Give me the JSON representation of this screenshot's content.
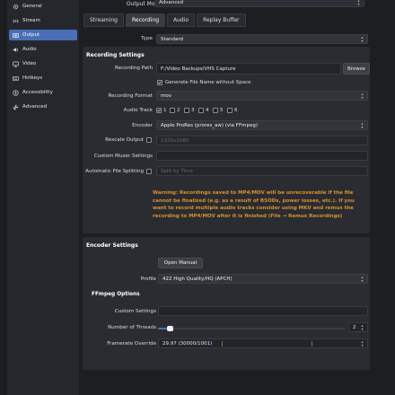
{
  "sidebar": {
    "items": [
      {
        "label": "General",
        "icon": "gear-icon"
      },
      {
        "label": "Stream",
        "icon": "broadcast-icon"
      },
      {
        "label": "Output",
        "icon": "output-icon"
      },
      {
        "label": "Audio",
        "icon": "speaker-icon"
      },
      {
        "label": "Video",
        "icon": "monitor-icon"
      },
      {
        "label": "Hotkeys",
        "icon": "keyboard-icon"
      },
      {
        "label": "Accessibility",
        "icon": "accessibility-icon"
      },
      {
        "label": "Advanced",
        "icon": "wrench-icon"
      }
    ],
    "active": "Output"
  },
  "output_mode": {
    "label": "Output Mode",
    "value": "Advanced"
  },
  "tabs": [
    "Streaming",
    "Recording",
    "Audio",
    "Replay Buffer"
  ],
  "active_tab": "Recording",
  "type": {
    "label": "Type",
    "value": "Standard"
  },
  "recording_settings": {
    "title": "Recording Settings",
    "path_label": "Recording Path",
    "path_value": "F:/Video Backups/VHS Capture",
    "browse": "Browse",
    "no_space_label": "Generate File Name without Space",
    "format_label": "Recording Format",
    "format_value": "mov",
    "audio_track_label": "Audio Track",
    "tracks": [
      "1",
      "2",
      "3",
      "4",
      "5",
      "6"
    ],
    "encoder_label": "Encoder",
    "encoder_value": "Apple ProRes (prores_aw) (via FFmpeg)",
    "rescale_label": "Rescale Output",
    "rescale_value": "1920x1080",
    "muxer_label": "Custom Muxer Settings",
    "muxer_value": "",
    "split_label": "Automatic File Splitting",
    "split_value": "Split by Time",
    "warning": "Warning: Recordings saved to MP4/MOV will be unrecoverable if the file cannot be finalized (e.g. as a result of BSODs, power losses, etc.). If you want to record multiple audio tracks consider using MKV and remux the recording to MP4/MOV after it is finished (File → Remux Recordings)"
  },
  "encoder_settings": {
    "title": "Encoder Settings",
    "open_manual": "Open Manual",
    "profile_label": "Profile",
    "profile_value": "422 High Quality/HQ (APCH)",
    "ffmpeg_title": "FFmpeg Options",
    "custom_label": "Custom Settings",
    "custom_value": "",
    "threads_label": "Number of Threads",
    "threads_value": "2",
    "threads_slider_fraction": 0.0,
    "framerate_label": "Framerate Override",
    "framerate_value": "29.97 (30000/1001)"
  },
  "colors": {
    "accent": "#4a6fb6",
    "warning": "#d8932a"
  }
}
